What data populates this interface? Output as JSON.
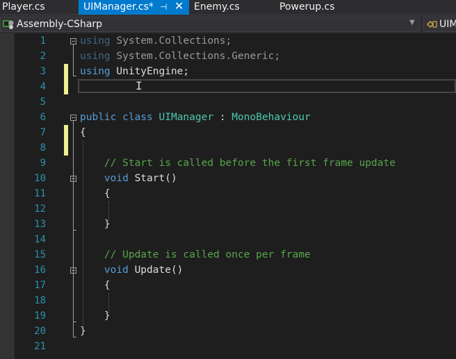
{
  "tabs": [
    {
      "label": "Player.cs"
    },
    {
      "label": "UIManager.cs*",
      "pin_glyph": "⊣",
      "close_glyph": "✕"
    },
    {
      "label": "Enemy.cs"
    },
    {
      "label": "Powerup.cs"
    }
  ],
  "navbar": {
    "project_label": "Assembly-CSharp",
    "dropdown_glyph": "▼",
    "scope_label": "UIM"
  },
  "editor": {
    "line_numbers": [
      "1",
      "2",
      "3",
      "4",
      "5",
      "6",
      "7",
      "8",
      "9",
      "10",
      "11",
      "12",
      "13",
      "14",
      "15",
      "16",
      "17",
      "18",
      "19",
      "20",
      "21"
    ],
    "ibeam_glyph": "I",
    "lines": {
      "l1": {
        "kw": "using",
        "rest": " System.Collections;"
      },
      "l2": {
        "kw": "using",
        "rest": " System.Collections.Generic;"
      },
      "l3": {
        "kw": "using",
        "rest": " UnityEngine;"
      },
      "l6": {
        "kw1": "public",
        "kw2": " class",
        "name": " UIManager",
        "sep": " : ",
        "base": "MonoBehaviour"
      },
      "l7": {
        "text": "{"
      },
      "l9": {
        "comment": "    // Start is called before the first frame update"
      },
      "l10": {
        "indent": "    ",
        "kw": "void",
        "name": " Start",
        "parens": "()"
      },
      "l11": {
        "text": "    {"
      },
      "l13": {
        "text": "    }"
      },
      "l15": {
        "comment": "    // Update is called once per frame"
      },
      "l16": {
        "indent": "    ",
        "kw": "void",
        "name": " Update",
        "parens": "()"
      },
      "l17": {
        "text": "    {"
      },
      "l19": {
        "text": "    }"
      },
      "l20": {
        "text": "}"
      }
    }
  },
  "colors": {
    "keyword": "#569cd6",
    "type": "#4ec9b0",
    "comment": "#57a64a",
    "line_number": "#2b91af",
    "active_tab": "#007acc",
    "change_marker": "#efef8f"
  }
}
